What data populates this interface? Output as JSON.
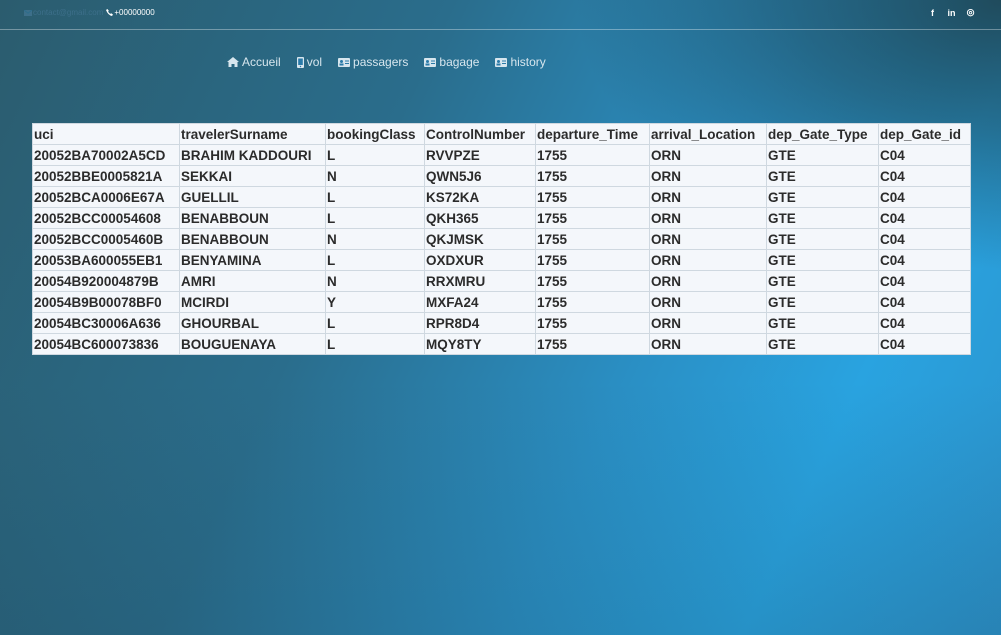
{
  "topbar": {
    "email": "contact@gmail.com",
    "phone": "+00000000",
    "social": [
      {
        "icon": "facebook-icon",
        "glyph": "f"
      },
      {
        "icon": "linkedin-icon",
        "glyph": "in"
      },
      {
        "icon": "instagram-icon",
        "glyph": "◎"
      }
    ]
  },
  "nav": {
    "items": [
      {
        "label": "Accueil",
        "icon": "home-icon"
      },
      {
        "label": "vol",
        "icon": "mobile-icon"
      },
      {
        "label": "passagers",
        "icon": "id-card-icon"
      },
      {
        "label": "bagage",
        "icon": "id-card-icon"
      },
      {
        "label": "history",
        "icon": "id-card-icon"
      }
    ]
  },
  "table": {
    "headers": [
      "uci",
      "travelerSurname",
      "bookingClass",
      "ControlNumber",
      "departure_Time",
      "arrival_Location",
      "dep_Gate_Type",
      "dep_Gate_id"
    ],
    "rows": [
      [
        "20052BA70002A5CD",
        "BRAHIM KADDOURI",
        "L",
        "RVVPZE",
        "1755",
        "ORN",
        "GTE",
        "C04"
      ],
      [
        "20052BBE0005821A",
        "SEKKAI",
        "N",
        "QWN5J6",
        "1755",
        "ORN",
        "GTE",
        "C04"
      ],
      [
        "20052BCA0006E67A",
        "GUELLIL",
        "L",
        "KS72KA",
        "1755",
        "ORN",
        "GTE",
        "C04"
      ],
      [
        "20052BCC00054608",
        "BENABBOUN",
        "L",
        "QKH365",
        "1755",
        "ORN",
        "GTE",
        "C04"
      ],
      [
        "20052BCC0005460B",
        "BENABBOUN",
        "N",
        "QKJMSK",
        "1755",
        "ORN",
        "GTE",
        "C04"
      ],
      [
        "20053BA600055EB1",
        "BENYAMINA",
        "L",
        "OXDXUR",
        "1755",
        "ORN",
        "GTE",
        "C04"
      ],
      [
        "20054B920004879B",
        "AMRI",
        "N",
        "RRXMRU",
        "1755",
        "ORN",
        "GTE",
        "C04"
      ],
      [
        "20054B9B00078BF0",
        "MCIRDI",
        "Y",
        "MXFA24",
        "1755",
        "ORN",
        "GTE",
        "C04"
      ],
      [
        "20054BC30006A636",
        "GHOURBAL",
        "L",
        "RPR8D4",
        "1755",
        "ORN",
        "GTE",
        "C04"
      ],
      [
        "20054BC600073836",
        "BOUGUENAYA",
        "L",
        "MQY8TY",
        "1755",
        "ORN",
        "GTE",
        "C04"
      ]
    ]
  }
}
